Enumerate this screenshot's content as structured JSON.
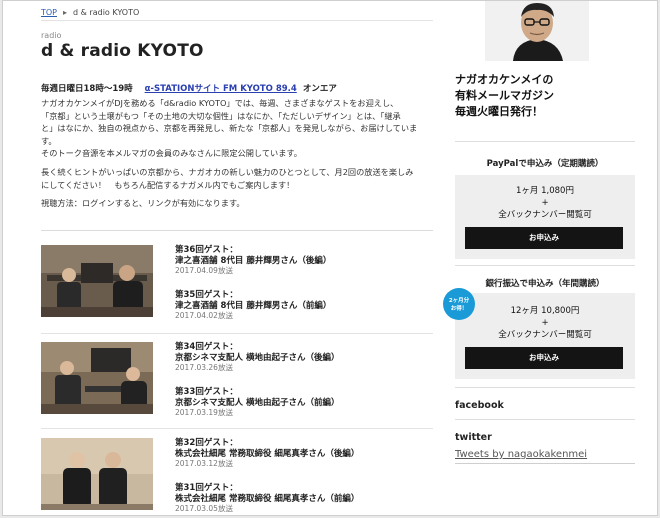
{
  "breadcrumb": {
    "home": "TOP",
    "separator": "▸",
    "current": "d & radio KYOTO"
  },
  "category": "radio",
  "title": "d & radio KYOTO",
  "onair": {
    "schedule": "毎週日曜日18時〜19時",
    "link": "α-STATIONサイト FM KYOTO 89.4",
    "suffix": "オンエア"
  },
  "description": [
    "ナガオカケンメイがDJを務める「d&radio KYOTO」では、毎週、さまざまなゲストをお迎えし、",
    "「京都」という土壌がもつ「その土地の大切な個性」はなにか、「ただしいデザイン」とは、「継承",
    "と」はなにか、独自の視点から、京都を再発見し、新たな「京都人」を発見しながら、お届けしていま",
    "す。",
    "そのトーク音源を本メルマガの会員のみなさんに限定公開しています。",
    "",
    "長く続くヒントがいっぱいの京都から、ナガオカの新しい魅力のひとつとして、月2回の放送を楽しみ",
    "にしてください！　もちろん配信するナガメル内でもご案内します！",
    "",
    "視聴方法：ログインすると、リンクが有効になります。"
  ],
  "episodes": [
    {
      "items": [
        {
          "guest": "第36回ゲスト：",
          "name": "津之喜酒舗 8代目 藤井輝男さん（後編）",
          "date": "2017.04.09放送"
        },
        {
          "guest": "第35回ゲスト：",
          "name": "津之喜酒舗 8代目 藤井輝男さん（前編）",
          "date": "2017.04.02放送"
        }
      ]
    },
    {
      "items": [
        {
          "guest": "第34回ゲスト：",
          "name": "京都シネマ支配人 横地由起子さん（後編）",
          "date": "2017.03.26放送"
        },
        {
          "guest": "第33回ゲスト：",
          "name": "京都シネマ支配人 横地由起子さん（前編）",
          "date": "2017.03.19放送"
        }
      ]
    },
    {
      "items": [
        {
          "guest": "第32回ゲスト：",
          "name": "株式会社細尾 常務取締役 細尾真孝さん（後編）",
          "date": "2017.03.12放送"
        },
        {
          "guest": "第31回ゲスト：",
          "name": "株式会社細尾 常務取締役 細尾真孝さん（前編）",
          "date": "2017.03.05放送"
        }
      ]
    }
  ],
  "sidebar": {
    "promo": [
      "ナガオカケンメイの",
      "有料メールマガジン",
      "毎週火曜日発行！"
    ],
    "paypal": {
      "heading": "PayPalで申込み（定期購読）",
      "price": "1ヶ月 1,080円",
      "plus": "+",
      "backnumber": "全バックナンバー閲覧可",
      "button": "お申込み"
    },
    "bank": {
      "heading": "銀行振込で申込み（年間購読）",
      "badge_line1": "2ヶ月分",
      "badge_line2": "お得！",
      "price": "12ヶ月 10,800円",
      "plus": "+",
      "backnumber": "全バックナンバー閲覧可",
      "button": "お申込み"
    },
    "facebook": "facebook",
    "twitter": "twitter",
    "tweets_link": "Tweets by nagaokakenmei"
  },
  "colors": {
    "link": "#2a3fb0",
    "button": "#141414",
    "badge": "#1a9bd7",
    "panel": "#eeeeee"
  }
}
